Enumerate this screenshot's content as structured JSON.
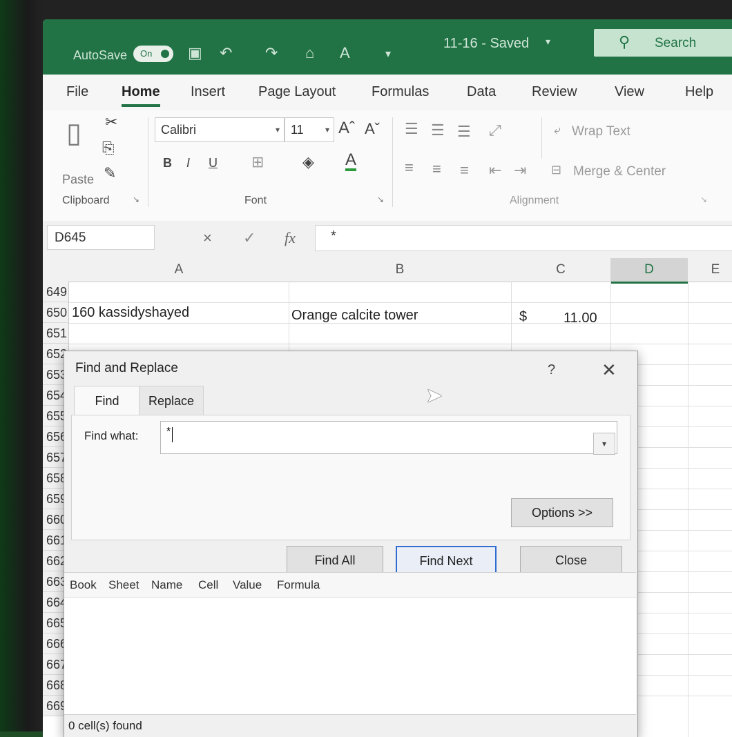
{
  "titlebar": {
    "autosave_label": "AutoSave",
    "autosave_state": "On",
    "doc_title": "11-16 - Saved",
    "search_label": "Search"
  },
  "tabs": [
    "File",
    "Home",
    "Insert",
    "Page Layout",
    "Formulas",
    "Data",
    "Review",
    "View",
    "Help"
  ],
  "ribbon": {
    "clipboard": {
      "label": "Clipboard",
      "paste": "Paste"
    },
    "font": {
      "label": "Font",
      "family": "Calibri",
      "size": "11",
      "bold": "B",
      "italic": "I",
      "underline": "U",
      "font_color": "A"
    },
    "alignment": {
      "label": "Alignment",
      "wrap_text": "Wrap Text",
      "merge_center": "Merge & Center"
    }
  },
  "formula_bar": {
    "name_box": "D645",
    "cancel": "×",
    "enter": "✓",
    "fx": "fx",
    "content": "*"
  },
  "grid": {
    "columns": [
      "A",
      "B",
      "C",
      "D",
      "E"
    ],
    "rows": [
      "649",
      "650",
      "651",
      "652",
      "653",
      "654",
      "655",
      "656",
      "657",
      "658",
      "659",
      "660",
      "661",
      "662",
      "663",
      "664",
      "665",
      "666",
      "667",
      "668",
      "669"
    ],
    "cells": {
      "a650": "160 kassidyshayed",
      "b650": "Orange calcite tower",
      "c650_currency": "$",
      "c650_value": "11.00"
    }
  },
  "dialog": {
    "title": "Find and Replace",
    "help": "?",
    "close_glyph": "✕",
    "tab_find": "Find",
    "tab_replace": "Replace",
    "find_what_label": "Find what:",
    "find_what_value": "*",
    "options_button": "Options >>",
    "find_all_button": "Find All",
    "find_next_button": "Find Next",
    "close_button": "Close",
    "result_columns": [
      "Book",
      "Sheet",
      "Name",
      "Cell",
      "Value",
      "Formula"
    ],
    "status": "0 cell(s) found"
  },
  "colors": {
    "accent": "#217346",
    "primary_button_border": "#2f6bd1"
  }
}
